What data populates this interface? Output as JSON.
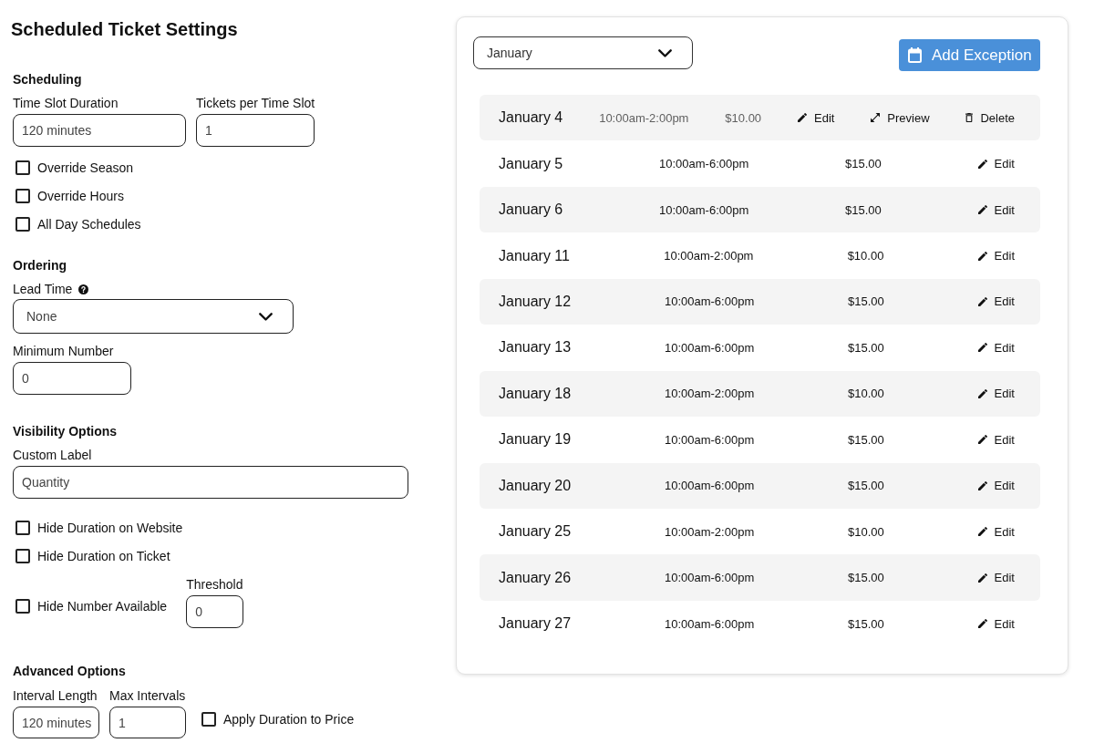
{
  "title": "Scheduled Ticket Settings",
  "sections": [
    {
      "heading": "Scheduling",
      "items": [
        {
          "kind": "fields",
          "fields": [
            {
              "label": "Time Slot Duration",
              "value": "120 minutes"
            },
            {
              "label": "Tickets per Time Slot",
              "value": "1"
            }
          ]
        },
        {
          "kind": "checkbox",
          "label": "Override Season",
          "checked": false
        },
        {
          "kind": "checkbox",
          "label": "Override Hours",
          "checked": false
        },
        {
          "kind": "checkbox",
          "label": "All Day Schedules",
          "checked": false
        }
      ]
    },
    {
      "heading": "Ordering",
      "items": [
        {
          "kind": "select",
          "label": "Lead Time",
          "help_icon": true,
          "value": "None"
        },
        {
          "kind": "fields",
          "fields": [
            {
              "label": "Minimum Number",
              "value": "0"
            }
          ]
        }
      ]
    },
    {
      "heading": "Visibility Options",
      "items": [
        {
          "kind": "fields",
          "fields": [
            {
              "label": "Custom Label",
              "value": "Quantity"
            }
          ]
        },
        {
          "kind": "checkbox",
          "label": "Hide Duration on Website",
          "checked": false
        },
        {
          "kind": "checkbox",
          "label": "Hide Duration on Ticket",
          "checked": false
        },
        {
          "kind": "checkbox",
          "label": "Hide Number Available",
          "checked": false,
          "field": {
            "label": "Threshold",
            "value": "0"
          }
        }
      ]
    },
    {
      "heading": "Advanced Options",
      "items": [
        {
          "kind": "fields",
          "fields": [
            {
              "label": "Interval Length",
              "value": "120 minutes"
            },
            {
              "label": "Max Intervals",
              "value": "1"
            }
          ],
          "checkbox": {
            "label": "Apply Duration to Price",
            "checked": false
          }
        }
      ]
    }
  ],
  "exceptions": {
    "month_select": {
      "value": "January"
    },
    "add_button": {
      "label": "Add Exception"
    },
    "rows": [
      {
        "date": "January 4",
        "time": "10:00am-2:00pm",
        "price": "$10.00",
        "selected": true,
        "actions": [
          {
            "kind": "edit",
            "label": "Edit"
          },
          {
            "kind": "preview",
            "label": "Preview"
          },
          {
            "kind": "delete",
            "label": "Delete"
          }
        ]
      },
      {
        "date": "January 5",
        "time": "10:00am-6:00pm",
        "price": "$15.00",
        "selected": false,
        "actions": [
          {
            "kind": "edit",
            "label": "Edit"
          }
        ]
      },
      {
        "date": "January 6",
        "time": "10:00am-6:00pm",
        "price": "$15.00",
        "selected": false,
        "actions": [
          {
            "kind": "edit",
            "label": "Edit"
          }
        ]
      },
      {
        "date": "January 11",
        "time": "10:00am-2:00pm",
        "price": "$10.00",
        "selected": false,
        "actions": [
          {
            "kind": "edit",
            "label": "Edit"
          }
        ]
      },
      {
        "date": "January 12",
        "time": "10:00am-6:00pm",
        "price": "$15.00",
        "selected": false,
        "actions": [
          {
            "kind": "edit",
            "label": "Edit"
          }
        ]
      },
      {
        "date": "January 13",
        "time": "10:00am-6:00pm",
        "price": "$15.00",
        "selected": false,
        "actions": [
          {
            "kind": "edit",
            "label": "Edit"
          }
        ]
      },
      {
        "date": "January 18",
        "time": "10:00am-2:00pm",
        "price": "$10.00",
        "selected": false,
        "actions": [
          {
            "kind": "edit",
            "label": "Edit"
          }
        ]
      },
      {
        "date": "January 19",
        "time": "10:00am-6:00pm",
        "price": "$15.00",
        "selected": false,
        "actions": [
          {
            "kind": "edit",
            "label": "Edit"
          }
        ]
      },
      {
        "date": "January 20",
        "time": "10:00am-6:00pm",
        "price": "$15.00",
        "selected": false,
        "actions": [
          {
            "kind": "edit",
            "label": "Edit"
          }
        ]
      },
      {
        "date": "January 25",
        "time": "10:00am-2:00pm",
        "price": "$10.00",
        "selected": false,
        "actions": [
          {
            "kind": "edit",
            "label": "Edit"
          }
        ]
      },
      {
        "date": "January 26",
        "time": "10:00am-6:00pm",
        "price": "$15.00",
        "selected": false,
        "actions": [
          {
            "kind": "edit",
            "label": "Edit"
          }
        ]
      },
      {
        "date": "January 27",
        "time": "10:00am-6:00pm",
        "price": "$15.00",
        "selected": false,
        "actions": [
          {
            "kind": "edit",
            "label": "Edit"
          }
        ]
      }
    ]
  }
}
